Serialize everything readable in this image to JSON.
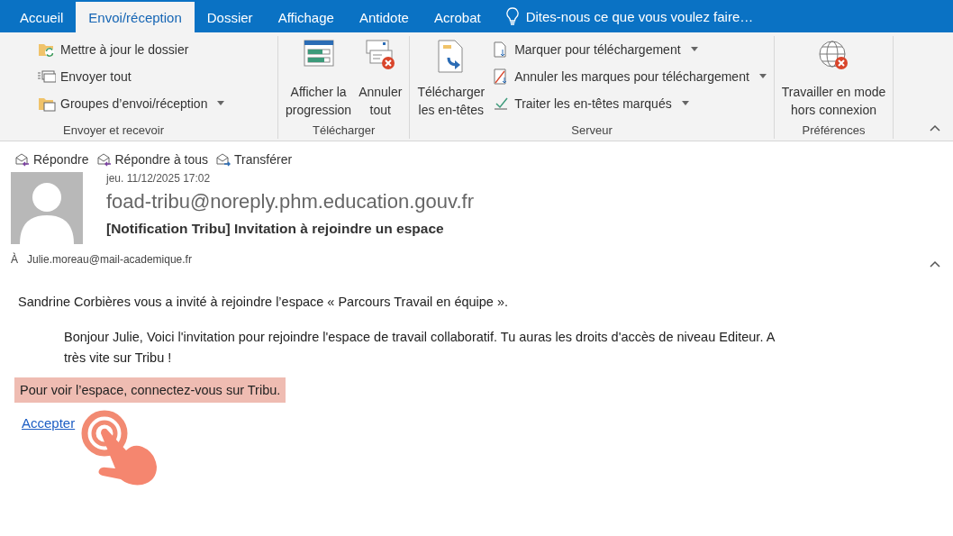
{
  "tabs": [
    {
      "label": "Accueil",
      "selected": false
    },
    {
      "label": "Envoi/réception",
      "selected": true
    },
    {
      "label": "Dossier",
      "selected": false
    },
    {
      "label": "Affichage",
      "selected": false
    },
    {
      "label": "Antidote",
      "selected": false
    },
    {
      "label": "Acrobat",
      "selected": false
    }
  ],
  "tell_me": {
    "placeholder": "Dites-nous ce que vous voulez faire…"
  },
  "ribbon": {
    "groups": [
      {
        "label": "Envoyer et recevoir",
        "items": [
          {
            "kind": "small",
            "label": "Mettre à jour le dossier",
            "dropdown": false
          },
          {
            "kind": "small",
            "label": "Envoyer tout",
            "dropdown": false
          },
          {
            "kind": "small",
            "label": "Groupes d’envoi/réception",
            "dropdown": true
          }
        ]
      },
      {
        "label": "Télécharger",
        "items": [
          {
            "kind": "large",
            "label": "Afficher la\nprogression",
            "dropdown": false
          },
          {
            "kind": "large",
            "label": "Annuler\ntout",
            "dropdown": false
          }
        ]
      },
      {
        "label": "Serveur",
        "items": [
          {
            "kind": "large",
            "label": "Télécharger\nles en-têtes",
            "dropdown": false
          },
          {
            "kind": "small",
            "label": "Marquer pour téléchargement",
            "dropdown": true
          },
          {
            "kind": "small",
            "label": "Annuler les marques pour téléchargement",
            "dropdown": true
          },
          {
            "kind": "small",
            "label": "Traiter les en-têtes marqués",
            "dropdown": true
          }
        ]
      },
      {
        "label": "Préférences",
        "items": [
          {
            "kind": "large",
            "label": "Travailler en mode\nhors connexion",
            "dropdown": false
          }
        ]
      }
    ]
  },
  "message": {
    "actions": [
      "Répondre",
      "Répondre à tous",
      "Transférer"
    ],
    "date": "jeu. 11/12/2025 17:02",
    "sender": "foad-tribu@noreply.phm.education.gouv.fr",
    "subject": "[Notification Tribu] Invitation à rejoindre un espace",
    "to_label": "À",
    "to": "Julie.moreau@mail-academique.fr"
  },
  "body": {
    "intro": "Sandrine Corbières vous a invité à rejoindre l’espace « Parcours Travail en équipe ».",
    "message": "Bonjour Julie, Voici l'invitation pour rejoindre l'espace de travail collaboratif. Tu auras les droits d'accès de niveau Editeur. A très vite sur Tribu !",
    "notice": "Pour voir l’espace, connectez-vous sur Tribu.",
    "link": "Accepter"
  }
}
